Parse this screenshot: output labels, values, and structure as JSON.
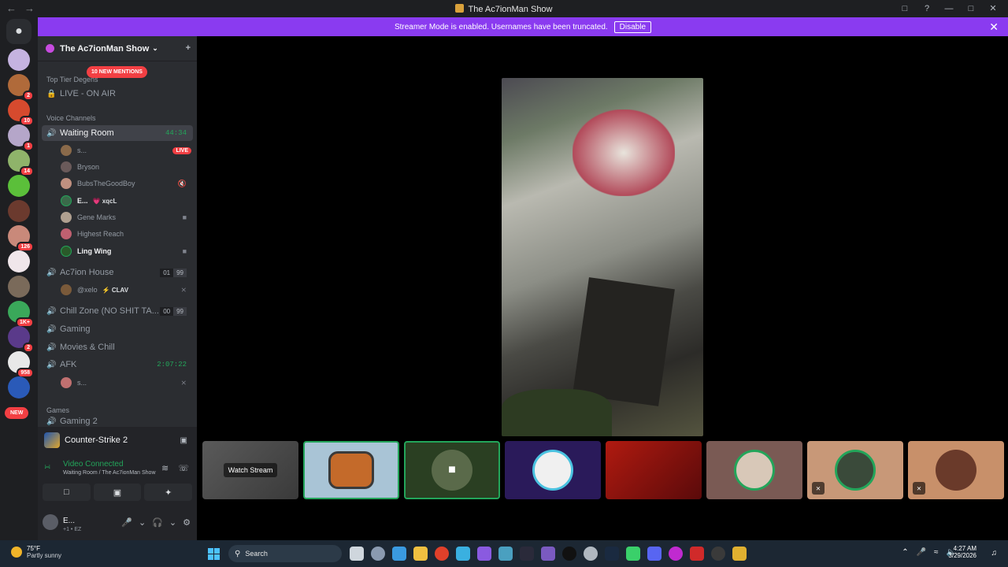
{
  "window": {
    "title": "The Ac7ionMan Show"
  },
  "banner": {
    "text": "Streamer Mode is enabled. Usernames have been truncated.",
    "button": "Disable"
  },
  "server": {
    "name": "The Ac7ionMan Show",
    "mentions_pill": "10 NEW MENTIONS",
    "new_pill": "NEW",
    "rail_badges": [
      "2",
      "10",
      "1",
      "14",
      "126",
      "1K+",
      "2",
      "958"
    ]
  },
  "channels": {
    "cat_top": "Top Tier Degens",
    "live_on_air": "LIVE - ON AIR",
    "cat_voice": "Voice Channels",
    "waiting_room": {
      "name": "Waiting Room",
      "duration": "44:34"
    },
    "waiting_users": [
      {
        "name": "s...",
        "badge": "LIVE"
      },
      {
        "name": "Bryson"
      },
      {
        "name": "BubsTheGoodBoy"
      },
      {
        "name": "E...",
        "tag": "💗 xqcL"
      },
      {
        "name": "Gene Marks"
      },
      {
        "name": "Highest Reach"
      },
      {
        "name": "Ling Wing"
      }
    ],
    "action_house": {
      "name": "Ac7ion House",
      "count_a": "01",
      "count_b": "99"
    },
    "action_users": [
      {
        "name": "@xelo",
        "tag": "⚡ CLAV"
      }
    ],
    "chill_zone": {
      "name": "Chill Zone (NO SHIT TA...",
      "count_a": "00",
      "count_b": "99"
    },
    "gaming": "Gaming",
    "movies": "Movies & Chill",
    "afk": {
      "name": "AFK",
      "duration": "2:07:22"
    },
    "afk_users": [
      {
        "name": "s..."
      }
    ],
    "cat_games": "Games",
    "gaming2": "Gaming 2"
  },
  "panel": {
    "activity": "Counter-Strike 2",
    "voice_status": "Video Connected",
    "voice_location": "Waiting Room / The Ac7ionMan Show",
    "me_name": "E...",
    "me_status": "+1 • EZ"
  },
  "stage": {
    "watch_stream": "Watch Stream"
  },
  "taskbar": {
    "temp": "75°F",
    "condition": "Partly sunny",
    "search": "Search",
    "time": "4:27 AM",
    "date": "3/29/2026"
  },
  "colors": {
    "accent": "#8a3bf0",
    "green": "#23a55a",
    "red": "#f23f43"
  }
}
